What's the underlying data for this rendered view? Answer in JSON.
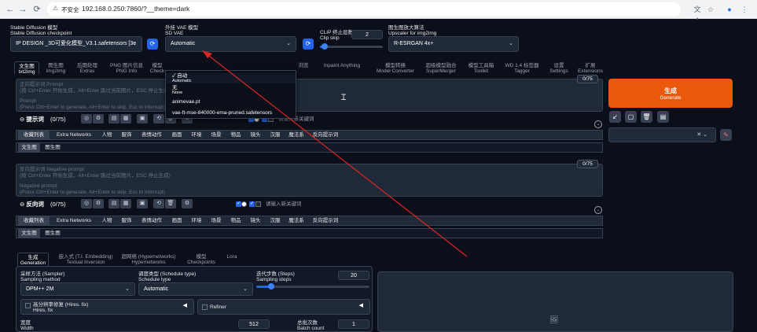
{
  "browser": {
    "back": "←",
    "forward": "→",
    "reload": "⟳",
    "not_secure": "不安全",
    "url": "192.168.0.250:7860/?__theme=dark",
    "translate_icon": "文A",
    "star_icon": "☆",
    "profile_icon": "●",
    "menu_icon": "⋮"
  },
  "top": {
    "model_label_cn": "Stable Diffusion 模型",
    "model_label_en": "Stable Diffusion checkpoint",
    "model_value": "IP DESIGN _3D可爱化模型_V3.1.safetensors [3e",
    "vae_label_cn": "外挂 VAE 模型",
    "vae_label_en": "SD VAE",
    "vae_value": "Automatic",
    "clip_label_cn": "CLIP 终止层数",
    "clip_label_en": "Clip skip",
    "clip_value": "2",
    "clip_fraction": 0.08,
    "upscaler_label_cn": "图生图放大算法",
    "upscaler_label_en": "Upscaler for img2img",
    "upscaler_value": "R-ESRGAN 4x+"
  },
  "vae_dropdown": [
    {
      "cn": "✓ 自动",
      "en": "Automatic"
    },
    {
      "cn": "无",
      "en": "None"
    },
    {
      "cn": "animevae.pt",
      "en": ""
    },
    {
      "cn": "vae-ft-mse-840000-ema-pruned.safetensors",
      "en": ""
    }
  ],
  "tabs": [
    {
      "cn": "文生图",
      "en": "txt2img"
    },
    {
      "cn": "图生图",
      "en": "img2img"
    },
    {
      "cn": "后期处理",
      "en": "Extras"
    },
    {
      "cn": "PNG 图片信息",
      "en": "PNG Info"
    },
    {
      "cn": "模型",
      "en": "Check"
    },
    {
      "cn": "浏览",
      "en": ""
    },
    {
      "cn": "Inpaint Anything",
      "en": ""
    },
    {
      "cn": "模型转换",
      "en": "Model Converter"
    },
    {
      "cn": "超级模型融合",
      "en": "SuperMerger"
    },
    {
      "cn": "模型工具箱",
      "en": "Toolkit"
    },
    {
      "cn": "WD 1.4 标签器",
      "en": "Tagger"
    },
    {
      "cn": "设置",
      "en": "Settings"
    },
    {
      "cn": "扩展",
      "en": "Extensions"
    }
  ],
  "prompt": {
    "ph1": "正向提示词 Prompt",
    "ph2": "(按 Ctrl+Enter 开始生成，Alt+Enter 跳过当前图片，ESC 停止生成)",
    "ph3": "Prompt",
    "ph4": "(Press Ctrl+Enter to generate, Alt+Enter to skip, Esc to interrupt)",
    "counter": "0/75",
    "label": "提示词",
    "label_count": "(0/75)",
    "keyword_placeholder": "请输入新关键词"
  },
  "neg": {
    "ph1": "反向提示词 Negative prompt",
    "ph2": "(按 Ctrl+Enter 开始生成，Alt+Enter 跳过当前图片，ESC 停止生成)",
    "ph3": "Negative prompt",
    "ph4": "(Press Ctrl+Enter to generate, Alt+Enter to skip, Esc to interrupt)",
    "counter": "0/75",
    "label": "反向词",
    "label_count": "(0/75)",
    "keyword_placeholder": "请输入新关键词"
  },
  "categories": [
    "收藏列表",
    "Extra Networks",
    "人物",
    "服饰",
    "表情动作",
    "画面",
    "环境",
    "场景",
    "物品",
    "镜头",
    "汉服",
    "魔法系",
    "反向提示词"
  ],
  "subcats": [
    "文生图",
    "图生图"
  ],
  "generate": {
    "cn": "生成",
    "en": "Generate"
  },
  "sub_tabs": [
    {
      "cn": "生成",
      "en": "Generation"
    },
    {
      "cn": "嵌入式 (T.I. Embedding)",
      "en": "Textual Inversion"
    },
    {
      "cn": "超网络 (Hypernetworks)",
      "en": "Hypernetworks"
    },
    {
      "cn": "模型",
      "en": "Checkpoints"
    },
    {
      "cn": "Lora",
      "en": ""
    }
  ],
  "settings": {
    "sampler_cn": "采样方法 (Sampler)",
    "sampler_en": "Sampling method",
    "sampler_value": "DPM++ 2M",
    "schedule_cn": "调度类型 (Schedule type)",
    "schedule_en": "Schedule type",
    "schedule_value": "Automatic",
    "steps_cn": "迭代步数 (Steps)",
    "steps_en": "Sampling steps",
    "steps_value": "20",
    "steps_fraction": 0.13,
    "hires_cn": "高分辨率修复 (Hires. fix)",
    "hires_en": "Hires. fix",
    "refiner": "Refiner",
    "width_cn": "宽度",
    "width_en": "Width",
    "width_value": "512",
    "batch_cn": "总批次数",
    "batch_en": "Batch count",
    "batch_value": "1"
  }
}
